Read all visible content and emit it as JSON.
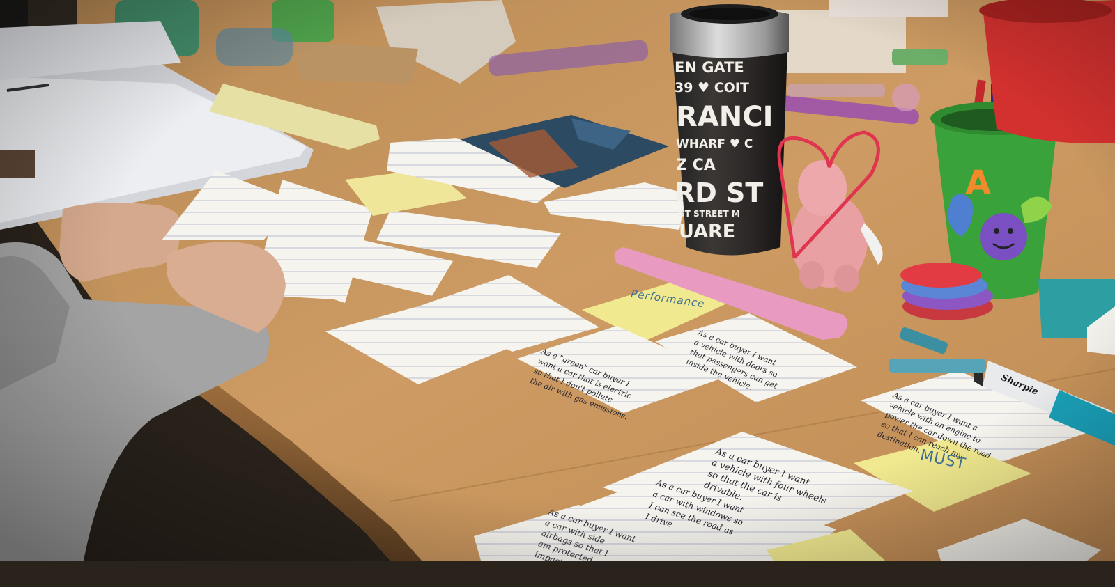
{
  "photo": {
    "subject": "Index cards with handwritten user stories arranged on a wooden table during a story-writing session",
    "colors": {
      "table": "#c7955c",
      "card": "#f6f4ee",
      "card_lines": "#b9bcd0",
      "sticky_yellow": "#f1e98f",
      "sweater": "#a4a4a4",
      "cup_green": "#3aa23a",
      "cup_red": "#d3312f",
      "pink_ruler": "#e99ac0"
    }
  },
  "cards": {
    "electric": "As a \"green\" car buyer I\nwant a car that is electric\nso that I don't pollute\nthe air with gas emissions.",
    "doors": "As a car buyer I want\na vehicle with doors so\nthat passengers can get\ninside the vehicle.",
    "engine": "As a car buyer I want a\nvehicle with an engine to\npower the car down the road\nso that I can reach my\ndestination.",
    "wheels": "As a car buyer I want\na vehicle with four wheels\nso that the car is\ndrivable.",
    "windows": "As a car buyer I want\na car with windows so\nI can see the road as\nI drive",
    "airbags": "As a car buyer I want\na car with side\nairbags so that I\nam protected on\nimpact"
  },
  "stickies": {
    "performance": "Performance",
    "must": "MUST"
  },
  "cup": {
    "lines": [
      "EN GATE",
      "39 ♥ COIT",
      "RANCI",
      "WHARF ♥ C",
      "Z  CA",
      "RD ST",
      "ST STREET M",
      "UARE"
    ]
  },
  "pencil_cup": {
    "letter": "A"
  },
  "marker": {
    "brand": "Sharpie"
  }
}
